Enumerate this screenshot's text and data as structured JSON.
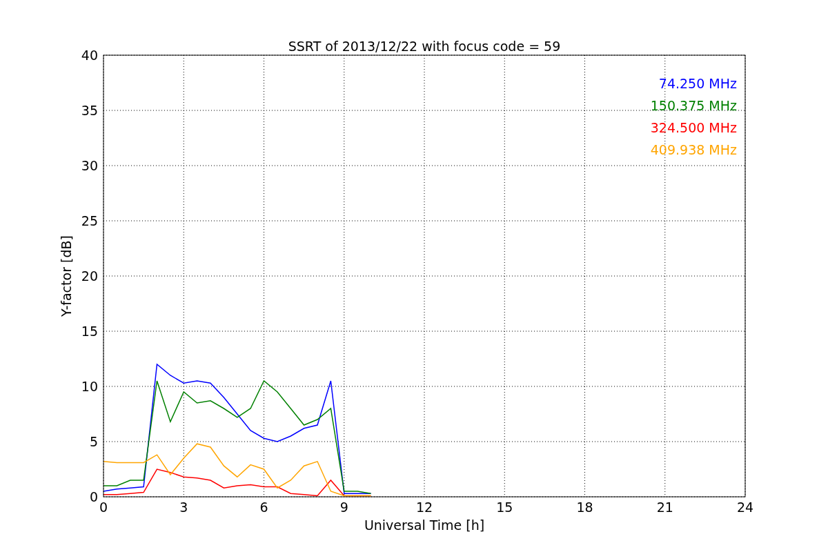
{
  "chart_data": {
    "type": "line",
    "title": "SSRT of 2013/12/22 with focus code = 59",
    "xlabel": "Universal Time [h]",
    "ylabel": "Y-factor [dB]",
    "x": [
      0,
      0.5,
      1,
      1.5,
      2,
      2.5,
      3,
      3.5,
      4,
      4.5,
      5,
      5.5,
      6,
      6.5,
      7,
      7.5,
      8,
      8.5,
      9,
      9.5,
      10
    ],
    "series": [
      {
        "name": "74.250 MHz",
        "color": "#0000ff",
        "values": [
          0.5,
          0.7,
          0.8,
          0.9,
          12,
          11,
          10.3,
          10.5,
          10.3,
          9,
          7.5,
          6,
          5.3,
          5,
          5.5,
          6.2,
          6.5,
          10.5,
          0.3,
          0.3,
          0.3
        ]
      },
      {
        "name": "150.375 MHz",
        "color": "#008000",
        "values": [
          1,
          1,
          1.5,
          1.5,
          10.5,
          6.8,
          9.5,
          8.5,
          8.7,
          8,
          7.2,
          8,
          10.5,
          9.5,
          8,
          6.5,
          7,
          8,
          0.5,
          0.5,
          0.3
        ]
      },
      {
        "name": "324.500 MHz",
        "color": "#ff0000",
        "values": [
          0.2,
          0.2,
          0.3,
          0.4,
          2.5,
          2.2,
          1.8,
          1.7,
          1.5,
          0.8,
          1,
          1.1,
          0.9,
          0.9,
          0.3,
          0.2,
          0.1,
          1.5,
          0.1,
          0.1,
          0.1
        ]
      },
      {
        "name": "409.938 MHz",
        "color": "#ffa500",
        "values": [
          3.2,
          3.1,
          3.1,
          3.1,
          3.8,
          2,
          3.5,
          4.8,
          4.5,
          2.8,
          1.8,
          2.9,
          2.5,
          0.8,
          1.5,
          2.8,
          3.2,
          0.5,
          0.1,
          0.1,
          0.1
        ]
      }
    ],
    "xlim": [
      0,
      24
    ],
    "ylim": [
      0,
      40
    ],
    "xticks": [
      0,
      3,
      6,
      9,
      12,
      15,
      18,
      21,
      24
    ],
    "yticks": [
      0,
      5,
      10,
      15,
      20,
      25,
      30,
      35,
      40
    ],
    "grid": true
  }
}
